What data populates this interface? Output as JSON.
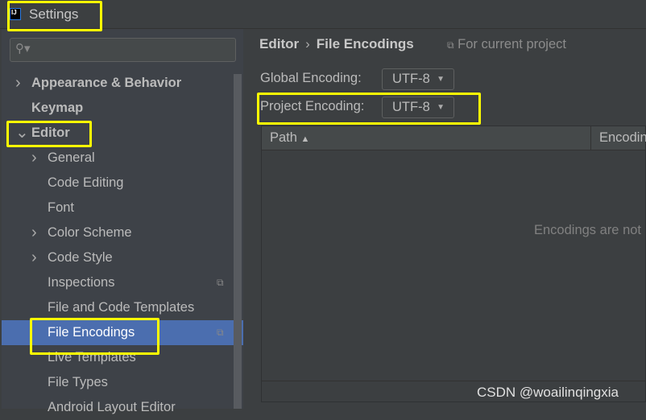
{
  "window": {
    "title": "Settings",
    "logo": "IJ"
  },
  "search": {
    "placeholder": "",
    "icon": "search-icon"
  },
  "sidebar": {
    "items": [
      {
        "label": "Appearance & Behavior",
        "bold": true,
        "expander": ">"
      },
      {
        "label": "Keymap",
        "bold": true
      },
      {
        "label": "Editor",
        "bold": true,
        "expander": "v"
      },
      {
        "label": "General",
        "expander": ">"
      },
      {
        "label": "Code Editing"
      },
      {
        "label": "Font"
      },
      {
        "label": "Color Scheme",
        "expander": ">"
      },
      {
        "label": "Code Style",
        "expander": ">"
      },
      {
        "label": "Inspections",
        "project_icon": true
      },
      {
        "label": "File and Code Templates"
      },
      {
        "label": "File Encodings",
        "selected": true,
        "project_icon": true
      },
      {
        "label": "Live Templates"
      },
      {
        "label": "File Types"
      },
      {
        "label": "Android Layout Editor"
      }
    ]
  },
  "main": {
    "breadcrumb": [
      "Editor",
      "File Encodings"
    ],
    "breadcrumb_sep": "›",
    "scope": "For current project",
    "global_label": "Global Encoding:",
    "global_value": "UTF-8",
    "project_label": "Project Encoding:",
    "project_value": "UTF-8",
    "table": {
      "columns": [
        "Path",
        "Encodin"
      ],
      "sort_indicator": "▲",
      "empty_text": "Encodings are not"
    },
    "toolbar": {
      "add": "+",
      "remove": "−",
      "edit": "✎"
    }
  },
  "watermark": "CSDN @woailinqingxia",
  "colors": {
    "selection": "#4b6eaf",
    "highlight": "#ffff00"
  }
}
